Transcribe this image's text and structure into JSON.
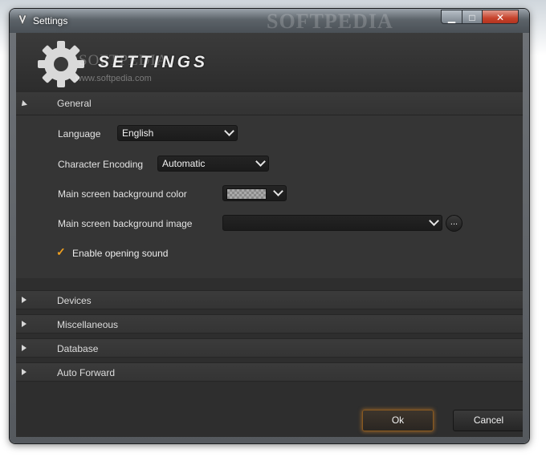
{
  "window": {
    "title": "Settings",
    "watermark": "SOFTPEDIA",
    "controls": {
      "minimize": "▁",
      "maximize": "□",
      "close": "✕"
    }
  },
  "header": {
    "logo_text": "SETTINGS",
    "watermark_text": "SOFTPEDIA",
    "watermark_url": "www.softpedia.com"
  },
  "general": {
    "label": "General",
    "language": {
      "label": "Language",
      "value": "English"
    },
    "encoding": {
      "label": "Character Encoding",
      "value": "Automatic"
    },
    "bg_color": {
      "label": "Main screen background color"
    },
    "bg_image": {
      "label": "Main screen background image",
      "value": "",
      "browse_label": "..."
    },
    "opening_sound": {
      "label": "Enable opening sound",
      "checked": true,
      "check_glyph": "✓"
    }
  },
  "sections": [
    {
      "label": "Devices"
    },
    {
      "label": "Miscellaneous"
    },
    {
      "label": "Database"
    },
    {
      "label": "Auto Forward"
    }
  ],
  "buttons": {
    "ok": "Ok",
    "cancel": "Cancel"
  },
  "colors": {
    "accent": "#f0a020",
    "panel": "#353535",
    "background": "#2e2e2e"
  }
}
